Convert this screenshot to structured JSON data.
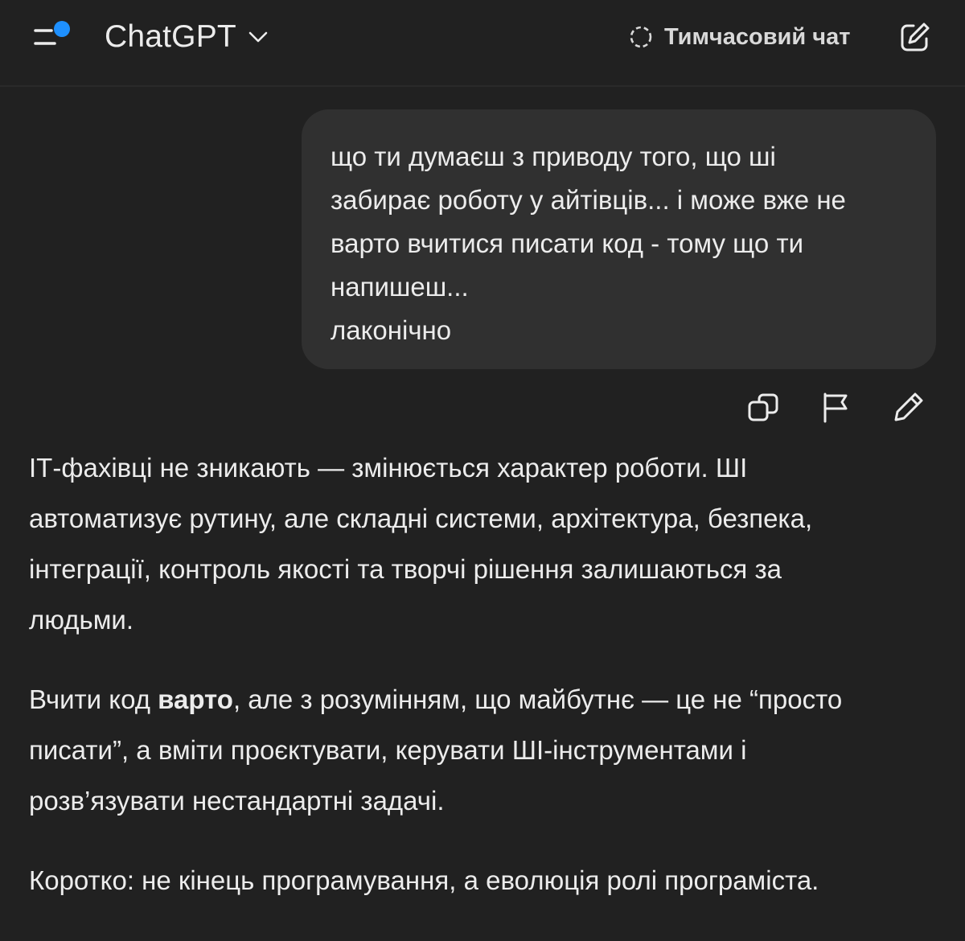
{
  "header": {
    "model_name": "ChatGPT",
    "temp_chat_label": "Тимчасовий чат",
    "icons": {
      "menu": "menu-icon",
      "chevron": "chevron-down-icon",
      "temp_chat": "temporary-chat-icon",
      "new_chat": "new-chat-icon"
    },
    "colors": {
      "notification_dot": "#1e90ff"
    }
  },
  "user_message": {
    "lines": [
      "що ти думаєш з приводу того, що ші",
      "забирає роботу у айтівців... і може вже не",
      "варто вчитися писати код - тому що ти",
      "напишеш...",
      "лаконічно"
    ]
  },
  "message_actions": [
    "copy-icon",
    "flag-icon",
    "edit-icon"
  ],
  "assistant_message": {
    "p1": [
      "ІТ-фахівці не зникають — змінюється характер роботи. ШІ",
      "автоматизує рутину, але складні системи, архітектура, безпека,",
      "інтеграції, контроль якості та творчі рішення залишаються за",
      "людьми."
    ],
    "p2": {
      "l1_before": "Вчити код ",
      "l1_bold": "варто",
      "l1_after": ", але з розумінням, що майбутнє — це не “просто",
      "l2": "писати”, а вміти проєктувати, керувати ШІ-інструментами і",
      "l3": "розв’язувати нестандартні задачі."
    },
    "p3": "Коротко: не кінець програмування, а еволюція ролі програміста."
  },
  "colors": {
    "background": "#212121",
    "bubble": "#303030",
    "text": "#ececec"
  }
}
